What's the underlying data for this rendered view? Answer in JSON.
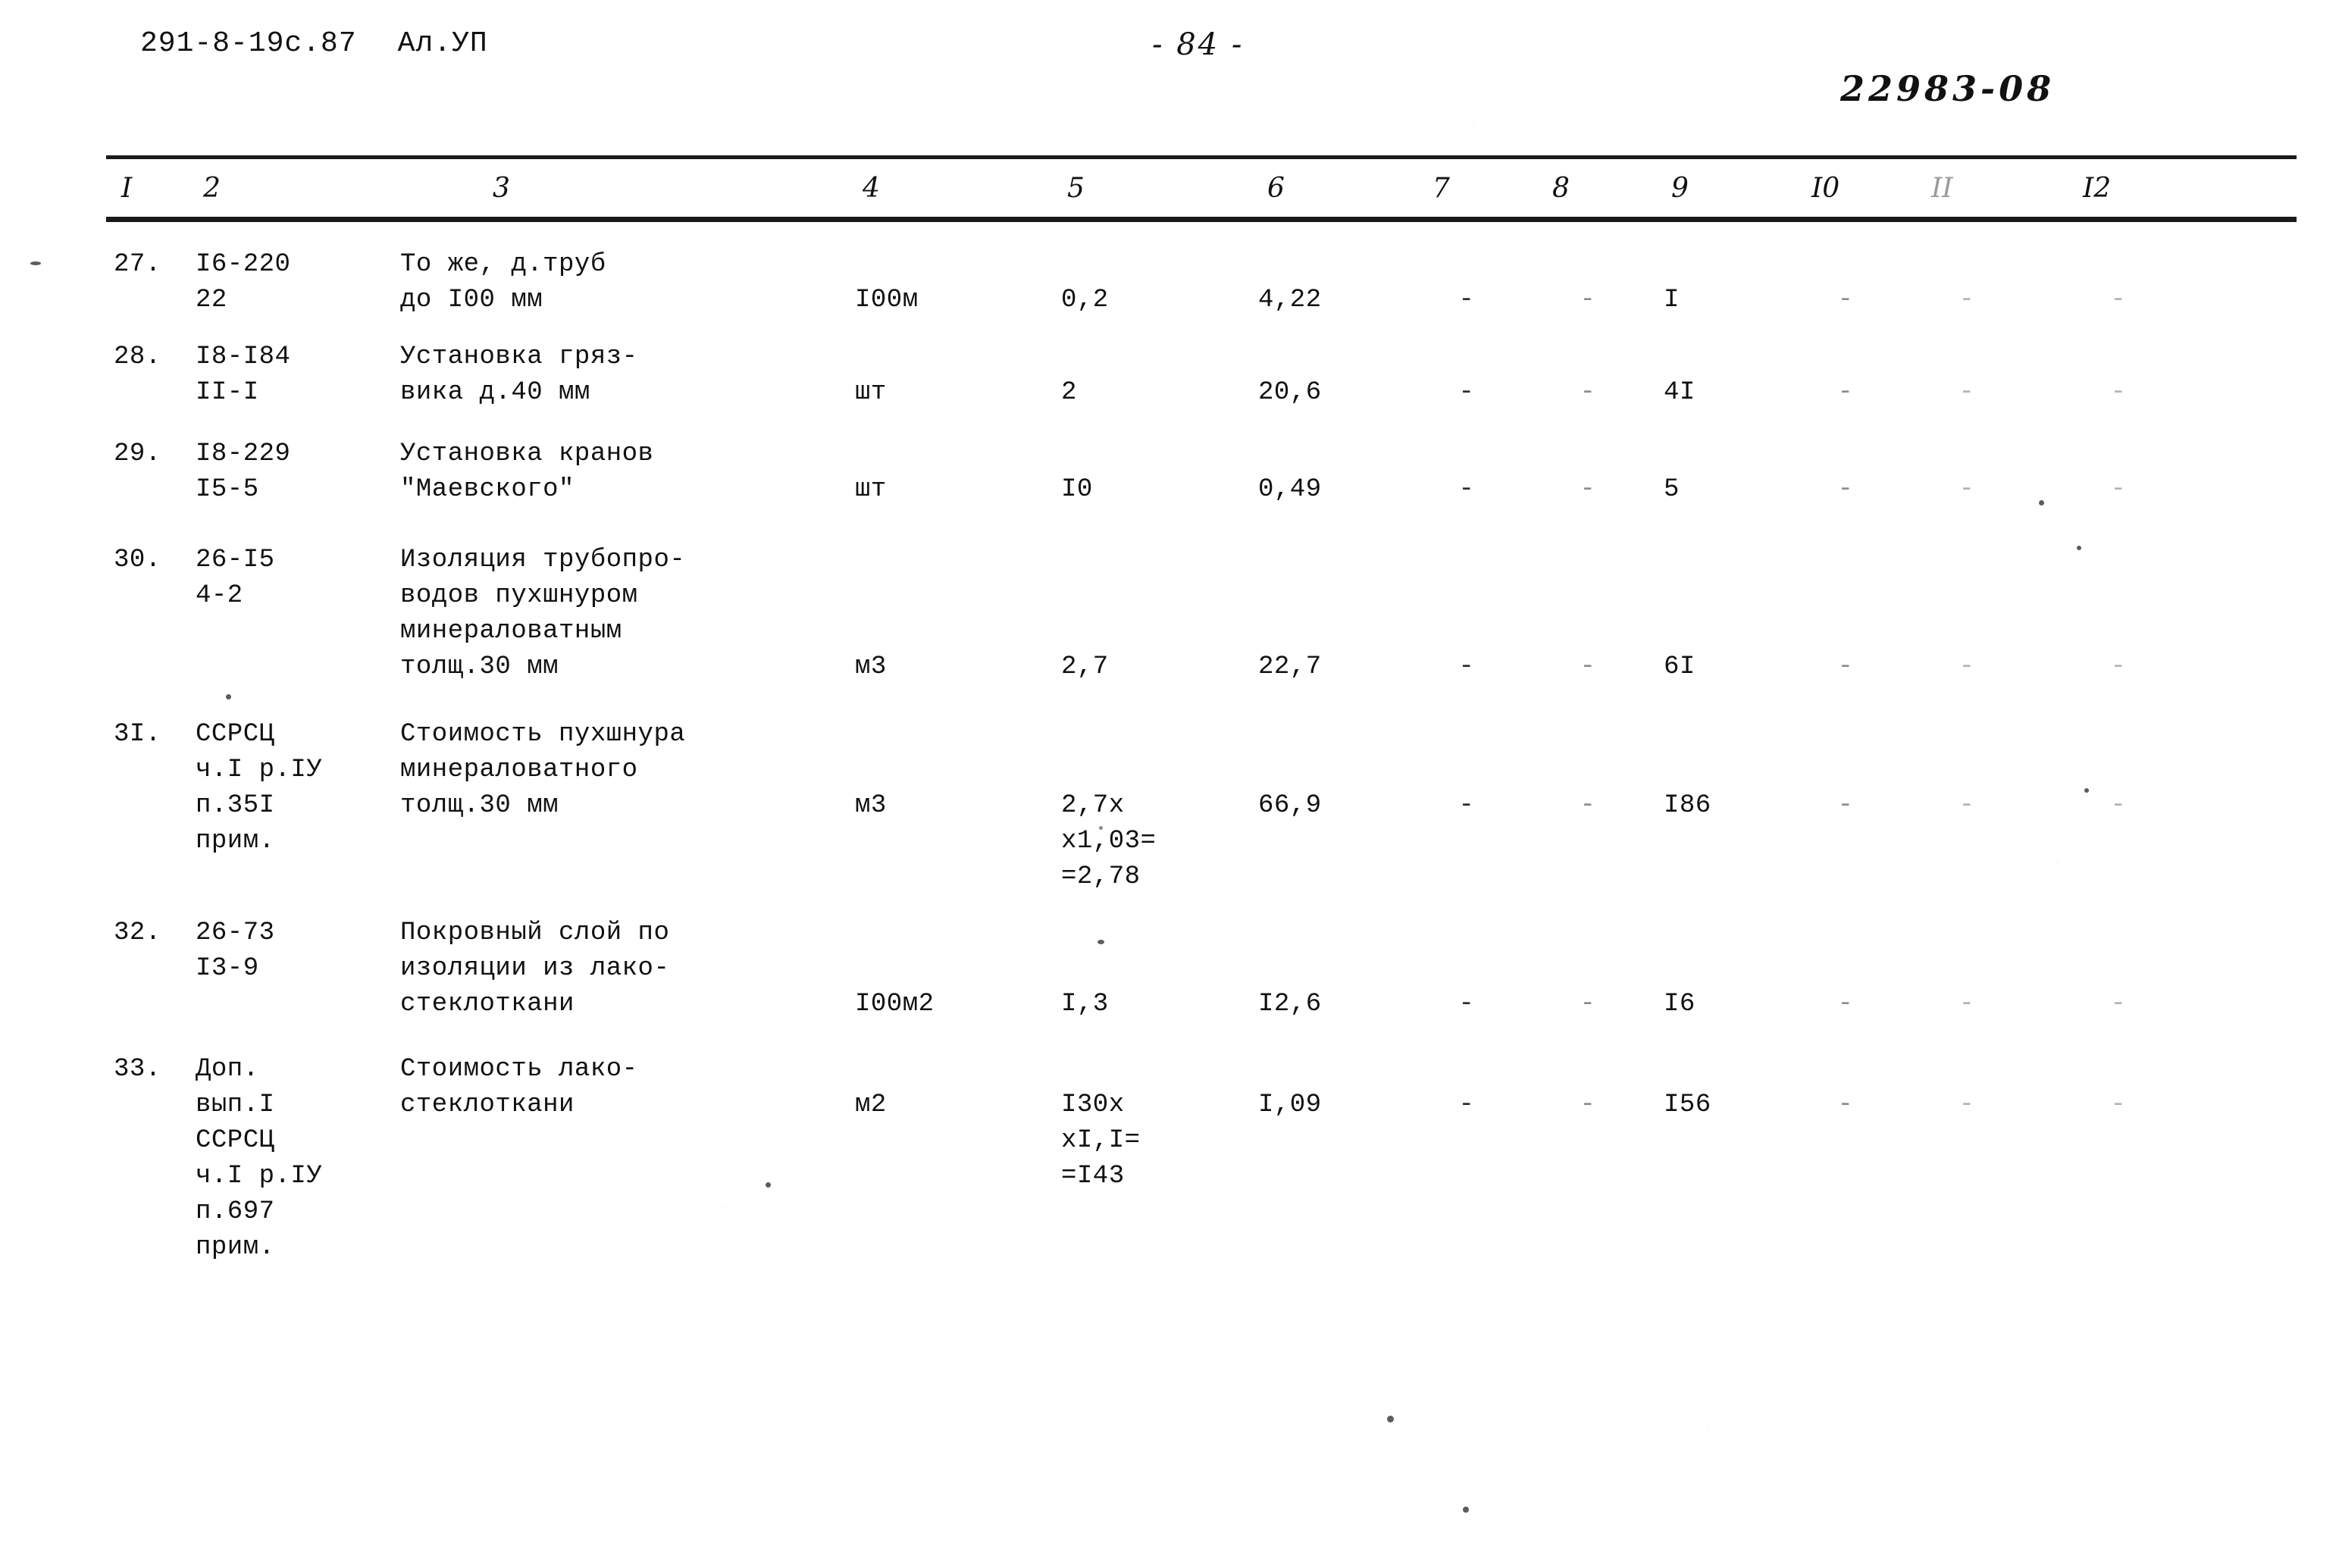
{
  "header": {
    "doc_code": "291-8-19с.87",
    "album": "Ал.УП",
    "page_number": "- 84 -",
    "archive_number": "22983-08"
  },
  "table": {
    "column_headers": [
      "I",
      "2",
      "3",
      "4",
      "5",
      "6",
      "7",
      "8",
      "9",
      "I0",
      "II",
      "I2"
    ],
    "rows": [
      {
        "num": "27.",
        "code": "I6-220\n22",
        "description": "То же, д.труб\nдо I00 мм",
        "unit": "I00м",
        "quantity": "0,2",
        "price": "4,22",
        "c7": "-",
        "c8": "-",
        "c9": "I",
        "c10": "-",
        "c11": "-",
        "c12": "-"
      },
      {
        "num": "28.",
        "code": "I8-I84\nII-I",
        "description": "Установка гряз-\nвика д.40 мм",
        "unit": "шт",
        "quantity": "2",
        "price": "20,6",
        "c7": "-",
        "c8": "-",
        "c9": "4I",
        "c10": "-",
        "c11": "-",
        "c12": "-"
      },
      {
        "num": "29.",
        "code": "I8-229\nI5-5",
        "description": "Установка кранов\n\"Маевского\"",
        "unit": "шт",
        "quantity": "I0",
        "price": "0,49",
        "c7": "-",
        "c8": "-",
        "c9": "5",
        "c10": "-",
        "c11": "-",
        "c12": "-"
      },
      {
        "num": "30.",
        "code": "26-I5\n4-2",
        "description": "Изоляция трубопро-\nводов пухшнуром\nминераловатным\nтолщ.30 мм",
        "unit": "м3",
        "quantity": "2,7",
        "price": "22,7",
        "c7": "-",
        "c8": "-",
        "c9": "6I",
        "c10": "-",
        "c11": "-",
        "c12": "-"
      },
      {
        "num": "3I.",
        "code": "ССРСЦ\nч.I р.IУ\nп.35I\nприм.",
        "description": "Стоимость пухшнура\nминераловатного\nтолщ.30 мм",
        "unit": "м3",
        "quantity": "2,7х\nх1,03=\n=2,78",
        "price": "66,9",
        "c7": "-",
        "c8": "-",
        "c9": "I86",
        "c10": "-",
        "c11": "-",
        "c12": "-"
      },
      {
        "num": "32.",
        "code": "26-73\nI3-9",
        "description": "Покровный слой по\nизоляции из лако-\nстеклоткани",
        "unit": "I00м2",
        "quantity": "I,3",
        "price": "I2,6",
        "c7": "-",
        "c8": "-",
        "c9": "I6",
        "c10": "-",
        "c11": "-",
        "c12": "-"
      },
      {
        "num": "33.",
        "code": "Доп.\nвып.I\nССРСЦ\nч.I р.IУ\nп.697\nприм.",
        "description": "Стоимость лако-\nстеклоткани",
        "unit": "м2",
        "quantity": "I30х\nхI,I=\n=I43",
        "price": "I,09",
        "c7": "-",
        "c8": "-",
        "c9": "I56",
        "c10": "-",
        "c11": "-",
        "c12": "-"
      }
    ]
  }
}
